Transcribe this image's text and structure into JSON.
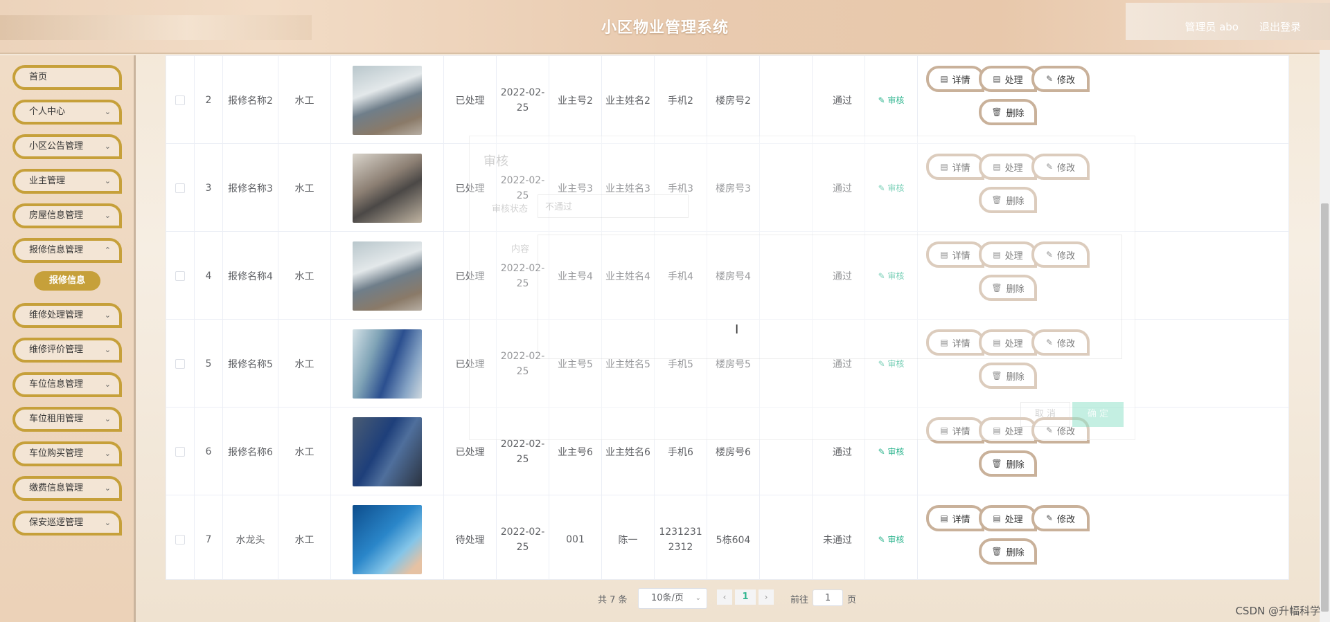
{
  "header": {
    "title": "小区物业管理系统",
    "user": "管理员 abo",
    "logout": "退出登录"
  },
  "sidebar": {
    "items": [
      {
        "label": "首页",
        "expandable": false
      },
      {
        "label": "个人中心",
        "expandable": true
      },
      {
        "label": "小区公告管理",
        "expandable": true
      },
      {
        "label": "业主管理",
        "expandable": true
      },
      {
        "label": "房屋信息管理",
        "expandable": true
      },
      {
        "label": "报修信息管理",
        "expandable": true
      },
      {
        "label": "维修处理管理",
        "expandable": true
      },
      {
        "label": "维修评价管理",
        "expandable": true
      },
      {
        "label": "车位信息管理",
        "expandable": true
      },
      {
        "label": "车位租用管理",
        "expandable": true
      },
      {
        "label": "车位购买管理",
        "expandable": true
      },
      {
        "label": "缴费信息管理",
        "expandable": true
      },
      {
        "label": "保安巡逻管理",
        "expandable": true
      }
    ],
    "active_sub": "报修信息"
  },
  "table": {
    "rows": [
      {
        "index": "2",
        "name": "报修名称2",
        "type": "水工",
        "photo": "plumber-sink",
        "status": "已处理",
        "date": "2022-02-25",
        "owner_no": "业主号2",
        "owner_name": "业主姓名2",
        "phone": "手机2",
        "building": "楼房号2",
        "audit": "通过"
      },
      {
        "index": "3",
        "name": "报修名称3",
        "type": "水工",
        "photo": "plumbers-pipes",
        "status": "已处理",
        "date": "2022-02-25",
        "owner_no": "业主号3",
        "owner_name": "业主姓名3",
        "phone": "手机3",
        "building": "楼房号3",
        "audit": "通过"
      },
      {
        "index": "4",
        "name": "报修名称4",
        "type": "水工",
        "photo": "plumber-sink",
        "status": "已处理",
        "date": "2022-02-25",
        "owner_no": "业主号4",
        "owner_name": "业主姓名4",
        "phone": "手机4",
        "building": "楼房号4",
        "audit": "通过"
      },
      {
        "index": "5",
        "name": "报修名称5",
        "type": "水工",
        "photo": "electrician-panel",
        "status": "已处理",
        "date": "2022-02-25",
        "owner_no": "业主号5",
        "owner_name": "业主姓名5",
        "phone": "手机5",
        "building": "楼房号5",
        "audit": "通过"
      },
      {
        "index": "6",
        "name": "报修名称6",
        "type": "水工",
        "photo": "electrician-board",
        "status": "已处理",
        "date": "2022-02-25",
        "owner_no": "业主号6",
        "owner_name": "业主姓名6",
        "phone": "手机6",
        "building": "楼房号6",
        "audit": "通过"
      },
      {
        "index": "7",
        "name": "水龙头",
        "type": "水工",
        "photo": "faucet",
        "status": "待处理",
        "date": "2022-02-25",
        "owner_no": "001",
        "owner_name": "陈一",
        "phone": "12312312312",
        "building": "5栋604",
        "audit": "未通过"
      }
    ],
    "audit_link": "审核",
    "actions": {
      "detail": "详情",
      "handle": "处理",
      "edit": "修改",
      "delete": "删除"
    }
  },
  "modal_ghost": {
    "title": "审核",
    "status_label": "审核状态",
    "status_value": "不通过",
    "content_label": "内容",
    "cancel": "取 消",
    "confirm": "确 定"
  },
  "pagination": {
    "total": "共 7 条",
    "page_size": "10条/页",
    "current_page": "1",
    "goto_label": "前往",
    "goto_value": "1",
    "goto_unit": "页"
  },
  "watermark": "CSDN @升幅科学",
  "colors": {
    "accent": "#c6a03a",
    "link_green": "#2fb58f",
    "button_border": "#c9b19a"
  }
}
